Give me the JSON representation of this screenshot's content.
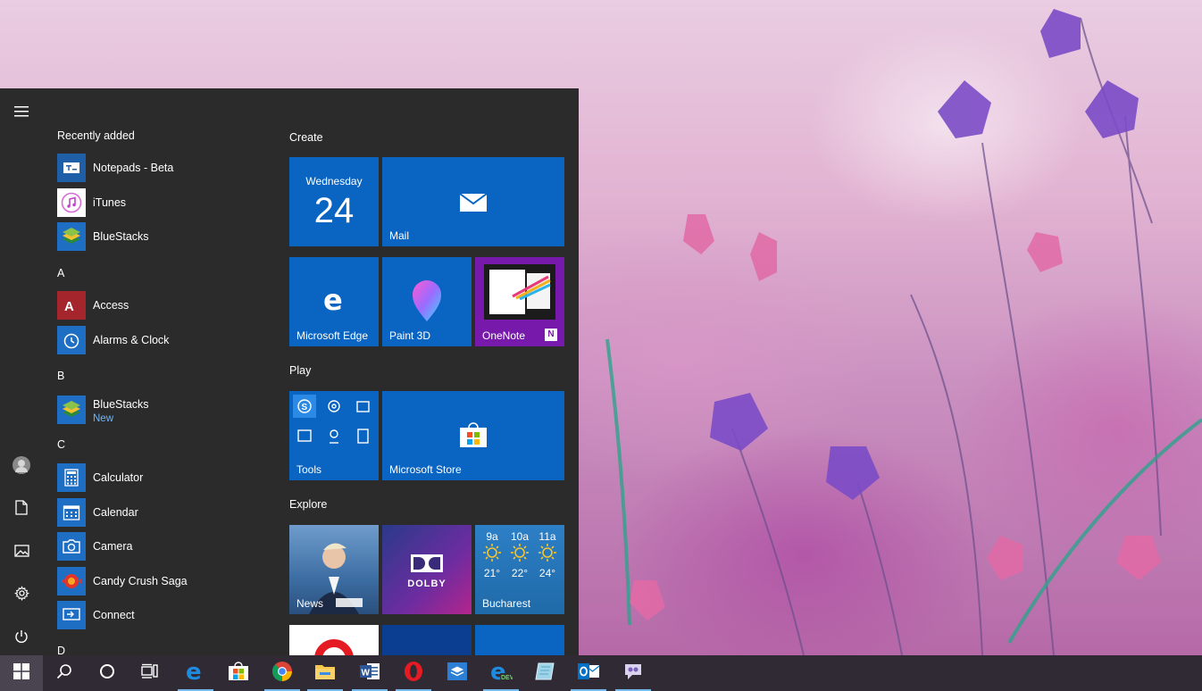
{
  "start_menu": {
    "rail": {
      "menu_icon": "hamburger-icon",
      "items": [
        {
          "name": "user-avatar",
          "icon": "avatar"
        },
        {
          "name": "documents",
          "icon": "document-icon"
        },
        {
          "name": "pictures",
          "icon": "picture-icon"
        },
        {
          "name": "settings",
          "icon": "gear-icon"
        },
        {
          "name": "power",
          "icon": "power-icon"
        }
      ]
    },
    "recently_added_label": "Recently added",
    "recent": [
      {
        "label": "Notepads - Beta"
      },
      {
        "label": "iTunes"
      },
      {
        "label": "BlueStacks"
      }
    ],
    "sections": [
      {
        "letter": "A",
        "apps": [
          {
            "label": "Access"
          },
          {
            "label": "Alarms & Clock"
          }
        ]
      },
      {
        "letter": "B",
        "apps": [
          {
            "label": "BlueStacks",
            "sub": "New"
          }
        ]
      },
      {
        "letter": "C",
        "apps": [
          {
            "label": "Calculator"
          },
          {
            "label": "Calendar"
          },
          {
            "label": "Camera"
          },
          {
            "label": "Candy Crush Saga"
          },
          {
            "label": "Connect"
          }
        ]
      },
      {
        "letter": "D",
        "apps": []
      }
    ],
    "groups": {
      "create": "Create",
      "play": "Play",
      "explore": "Explore"
    },
    "tiles": {
      "calendar_day": "Wednesday",
      "calendar_date": "24",
      "mail": "Mail",
      "edge": "Microsoft Edge",
      "paint3d": "Paint 3D",
      "onenote": "OneNote",
      "tools": "Tools",
      "store": "Microsoft Store",
      "news": "News",
      "dolby": "DOLBY",
      "weather_city": "Bucharest",
      "weather": [
        {
          "hour": "9a",
          "temp": "21°"
        },
        {
          "hour": "10a",
          "temp": "22°"
        },
        {
          "hour": "11a",
          "temp": "24°"
        }
      ]
    }
  },
  "taskbar": {
    "items": [
      "windows-start",
      "search",
      "cortana",
      "task-view",
      "edge",
      "store",
      "chrome",
      "file-explorer",
      "word",
      "opera",
      "sandbox",
      "edge-dev",
      "notepad-app",
      "outlook",
      "messenger-app"
    ]
  },
  "colors": {
    "tile_blue": "#0a64c2",
    "start_bg": "#2b2b2b",
    "taskbar_bg": "#2f2a33",
    "accent_light": "#69b7ff"
  }
}
